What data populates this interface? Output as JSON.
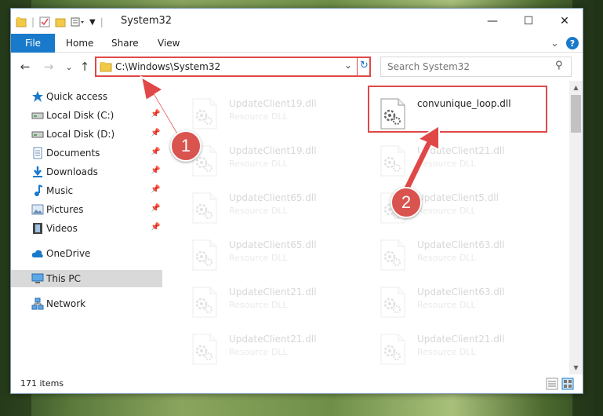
{
  "window": {
    "title": "System32",
    "minimize_glyph": "—",
    "maximize_glyph": "☐",
    "close_glyph": "✕"
  },
  "ribbon": {
    "file": "File",
    "home": "Home",
    "share": "Share",
    "view": "View",
    "expand_glyph": "⌄",
    "help_glyph": "?"
  },
  "nav": {
    "back_glyph": "←",
    "forward_glyph": "→",
    "recent_glyph": "⌄",
    "up_glyph": "↑",
    "address": "C:\\Windows\\System32",
    "refresh_glyph": "↻",
    "dropdown_glyph": "⌄",
    "search_placeholder": "Search System32",
    "search_glyph": "⚲"
  },
  "sidebar": {
    "items": [
      {
        "label": "Quick access",
        "icon": "star-icon",
        "pinned": false
      },
      {
        "label": "Local Disk (C:)",
        "icon": "drive-icon",
        "pinned": true
      },
      {
        "label": "Local Disk (D:)",
        "icon": "drive-icon",
        "pinned": true
      },
      {
        "label": "Documents",
        "icon": "documents-icon",
        "pinned": true
      },
      {
        "label": "Downloads",
        "icon": "download-icon",
        "pinned": true
      },
      {
        "label": "Music",
        "icon": "music-icon",
        "pinned": true
      },
      {
        "label": "Pictures",
        "icon": "pictures-icon",
        "pinned": true
      },
      {
        "label": "Videos",
        "icon": "videos-icon",
        "pinned": true
      },
      {
        "label": "OneDrive",
        "icon": "cloud-icon",
        "pinned": false
      },
      {
        "label": "This PC",
        "icon": "computer-icon",
        "pinned": false,
        "selected": true
      },
      {
        "label": "Network",
        "icon": "network-icon",
        "pinned": false
      }
    ],
    "pin_glyph": "📌"
  },
  "files": [
    {
      "name": "UpdateClient19.dll",
      "desc": "Resource DLL"
    },
    {
      "name": "convunique_loop.dll",
      "desc": ""
    },
    {
      "name": "UpdateClient19.dll",
      "desc": "Resource DLL"
    },
    {
      "name": "UpdateClient21.dll",
      "desc": "Resource DLL"
    },
    {
      "name": "UpdateClient65.dll",
      "desc": "Resource DLL"
    },
    {
      "name": "UpdateClient5.dll",
      "desc": "Resource DLL"
    },
    {
      "name": "UpdateClient65.dll",
      "desc": "Resource DLL"
    },
    {
      "name": "UpdateClient63.dll",
      "desc": "Resource DLL"
    },
    {
      "name": "UpdateClient21.dll",
      "desc": "Resource DLL"
    },
    {
      "name": "UpdateClient63.dll",
      "desc": "Resource DLL"
    },
    {
      "name": "UpdateClient21.dll",
      "desc": "Resource DLL"
    },
    {
      "name": "UpdateClient21.dll",
      "desc": "Resource DLL"
    }
  ],
  "status": {
    "item_count": "171 items"
  },
  "annotations": {
    "step1": "1",
    "step2": "2",
    "color": "#e04848"
  },
  "colors": {
    "accent": "#1979ca",
    "highlight": "#e04848",
    "selected_bg": "#d9d9d9"
  }
}
